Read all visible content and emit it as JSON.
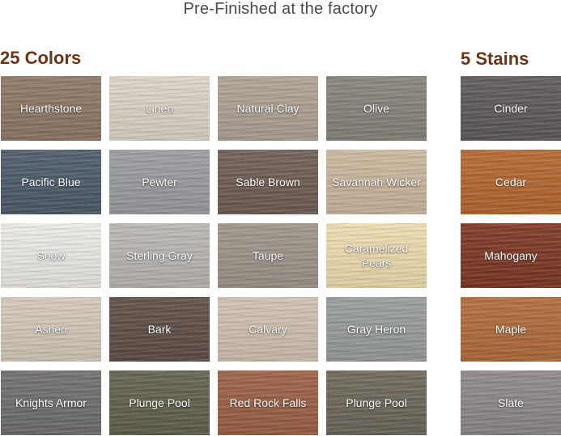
{
  "page": {
    "title": "Pre-Finished at the factory",
    "colors_heading": "25 Colors",
    "stains_heading": "5 Stains"
  },
  "colors": [
    {
      "label": "Hearthstone",
      "color": "#8d7663"
    },
    {
      "label": "Linen",
      "color": "#ddd4c6"
    },
    {
      "label": "Natural Clay",
      "color": "#aea193"
    },
    {
      "label": "Olive",
      "color": "#86817a"
    },
    {
      "label": "Pacific Blue",
      "color": "#4b5967"
    },
    {
      "label": "Pewter",
      "color": "#999b9e"
    },
    {
      "label": "Sable Brown",
      "color": "#6e5b52"
    },
    {
      "label": "Savannah Wicker",
      "color": "#cbb79c"
    },
    {
      "label": "Snow",
      "color": "#ecebe6"
    },
    {
      "label": "Sterling Gray",
      "color": "#b9b6b2"
    },
    {
      "label": "Taupe",
      "color": "#9d9389"
    },
    {
      "label": "Caramelized Pears",
      "color": "#efdcae"
    },
    {
      "label": "Ashen",
      "color": "#d4c8b9"
    },
    {
      "label": "Bark",
      "color": "#5c4c44"
    },
    {
      "label": "Calvary",
      "color": "#cfc1af"
    },
    {
      "label": "Gray Heron",
      "color": "#979c99"
    },
    {
      "label": "Knights Armor",
      "color": "#6f6d6b"
    },
    {
      "label": "Plunge Pool",
      "color": "#5f5f4a"
    },
    {
      "label": "Red Rock Falls",
      "color": "#9b5e43"
    },
    {
      "label": "Plunge Pool",
      "color": "#6b6558"
    }
  ],
  "stains": [
    {
      "label": "Cinder",
      "color": "#5c5759"
    },
    {
      "label": "Cedar",
      "color": "#b4652d"
    },
    {
      "label": "Mahogany",
      "color": "#7b3520"
    },
    {
      "label": "Maple",
      "color": "#b06a38"
    },
    {
      "label": "Slate",
      "color": "#8d8786"
    }
  ]
}
